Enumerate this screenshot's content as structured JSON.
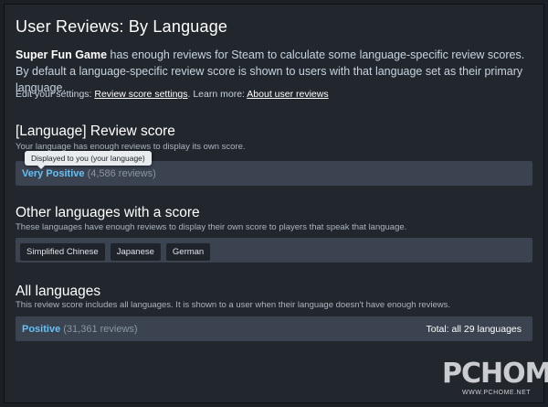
{
  "header": {
    "title": "User Reviews: By Language"
  },
  "intro": {
    "game_name": "Super Fun Game",
    "text": " has enough reviews for Steam to calculate some language-specific review scores. By default a language-specific review score is shown to users with that language set as their primary language."
  },
  "settings": {
    "prefix": "Edit your settings: ",
    "settings_link": "Review score settings",
    "learn_more": ". Learn more: ",
    "about_link": "About user reviews"
  },
  "language_score": {
    "title": "[Language] Review score",
    "subtitle": "Your language has enough reviews to display its own score.",
    "tooltip": "Displayed to you (your language)",
    "rating": "Very Positive",
    "count": "(4,586 reviews)"
  },
  "other_languages": {
    "title": "Other languages with a score",
    "subtitle": "These languages have enough reviews to display their own score to players that speak that language.",
    "chips": [
      "Simplified Chinese",
      "Japanese",
      "German"
    ]
  },
  "all_languages": {
    "title": "All languages",
    "subtitle": "This review score includes all languages. It is shown to a user when their language doesn't have enough reviews.",
    "rating": "Positive",
    "count": "(31,361 reviews)",
    "total": "Total: all 29 languages"
  },
  "watermark": {
    "main": "PCHOME",
    "sub": "WWW.PCHOME.NET"
  },
  "colors": {
    "accent": "#66c0f4",
    "bar": "#3b4350",
    "background": "#22262d"
  }
}
